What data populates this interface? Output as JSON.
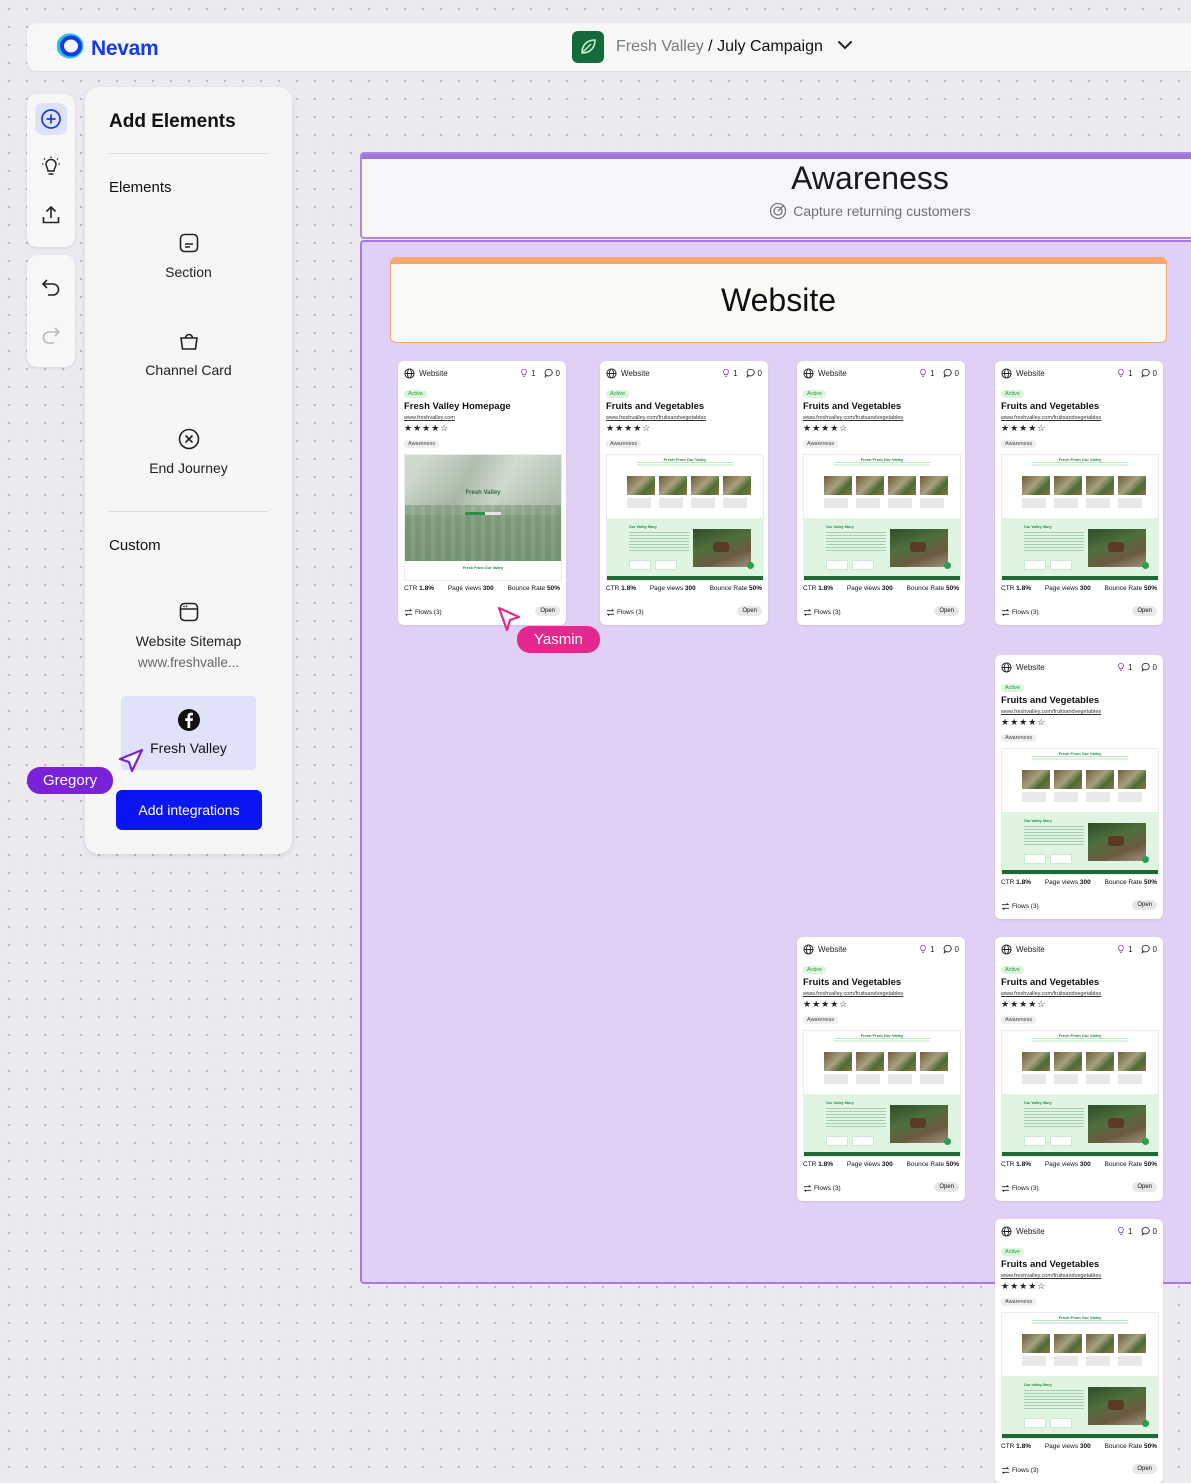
{
  "header": {
    "brand": "Nevam",
    "project": "Fresh Valley",
    "separator": " / ",
    "campaign": "July Campaign"
  },
  "toolbar": {
    "top_icons": [
      "add-circle-icon",
      "lightbulb-icon",
      "upload-icon"
    ],
    "history_icons": [
      "undo-icon",
      "redo-icon"
    ]
  },
  "panel": {
    "title": "Add Elements",
    "elements_heading": "Elements",
    "elements": [
      {
        "label": "Section",
        "icon": "section-icon"
      },
      {
        "label": "Channel Card",
        "icon": "basket-icon"
      },
      {
        "label": "End Journey",
        "icon": "close-circle-icon"
      }
    ],
    "custom_heading": "Custom",
    "custom": [
      {
        "label": "Website Sitemap",
        "sub": "www.freshvalle...",
        "icon": "browser-icon"
      },
      {
        "label": "Fresh Valley",
        "icon": "facebook-icon"
      }
    ],
    "add_button": "Add integrations"
  },
  "canvas": {
    "stage_title": "Awareness",
    "stage_subtitle": "Capture returning customers",
    "channel_title": "Website"
  },
  "cards": [
    {
      "channel": "Website",
      "ideas": "1",
      "comments": "0",
      "status": "Active",
      "title": "Fresh Valley Homepage",
      "url": "www.freshvalley.com",
      "rating": "★★★★☆",
      "tag": "Awareness",
      "preview": "homepage",
      "preview_title": "Fresh Valley",
      "preview_footer": "Fresh From Our Valley",
      "ctr_label": "CTR",
      "ctr": "1.8%",
      "views_label": "Page views",
      "views": "300",
      "bounce_label": "Bounce Rate",
      "bounce": "50%",
      "flows": "Flows (3)",
      "open": "Open"
    },
    {
      "channel": "Website",
      "ideas": "1",
      "comments": "0",
      "status": "Active",
      "title": "Fruits and Vegetables",
      "url": "www.freshvalley.com/fruitsandvegetables",
      "rating": "★★★★☆",
      "tag": "Awareness",
      "preview": "product",
      "preview_title": "Fresh From Our Valley",
      "preview_story": "Our Valley Story",
      "ctr_label": "CTR",
      "ctr": "1.8%",
      "views_label": "Page views",
      "views": "300",
      "bounce_label": "Bounce Rate",
      "bounce": "50%",
      "flows": "Flows (3)",
      "open": "Open"
    },
    {
      "channel": "Website",
      "ideas": "1",
      "comments": "0",
      "status": "Active",
      "title": "Fruits and Vegetables",
      "url": "www.freshvalley.com/fruitsandvegetables",
      "rating": "★★★★☆",
      "tag": "Awareness",
      "preview": "product",
      "preview_title": "Fresh From Our Valley",
      "preview_story": "Our Valley Story",
      "ctr_label": "CTR",
      "ctr": "1.8%",
      "views_label": "Page views",
      "views": "300",
      "bounce_label": "Bounce Rate",
      "bounce": "50%",
      "flows": "Flows (3)",
      "open": "Open"
    },
    {
      "channel": "Website",
      "ideas": "1",
      "comments": "0",
      "status": "Active",
      "title": "Fruits and Vegetables",
      "url": "www.freshvalley.com/fruitsandvegetables",
      "rating": "★★★★☆",
      "tag": "Awareness",
      "preview": "product",
      "preview_title": "Fresh From Our Valley",
      "preview_story": "Our Valley Story",
      "ctr_label": "CTR",
      "ctr": "1.8%",
      "views_label": "Page views",
      "views": "300",
      "bounce_label": "Bounce Rate",
      "bounce": "50%",
      "flows": "Flows (3)",
      "open": "Open"
    },
    {
      "channel": "Website",
      "ideas": "1",
      "comments": "0",
      "status": "Active",
      "title": "Fruits and Vegetables",
      "url": "www.freshvalley.com/fruitsandvegetables",
      "rating": "★★★★☆",
      "tag": "Awareness",
      "preview": "product",
      "preview_title": "Fresh From Our Valley",
      "preview_story": "Our Valley Story",
      "ctr_label": "CTR",
      "ctr": "1.8%",
      "views_label": "Page views",
      "views": "300",
      "bounce_label": "Bounce Rate",
      "bounce": "50%",
      "flows": "Flows (3)",
      "open": "Open"
    },
    {
      "channel": "Website",
      "ideas": "1",
      "comments": "0",
      "status": "Active",
      "title": "Fruits and Vegetables",
      "url": "www.freshvalley.com/fruitsandvegetables",
      "rating": "★★★★☆",
      "tag": "Awareness",
      "preview": "product",
      "preview_title": "Fresh From Our Valley",
      "preview_story": "Our Valley Story",
      "ctr_label": "CTR",
      "ctr": "1.8%",
      "views_label": "Page views",
      "views": "300",
      "bounce_label": "Bounce Rate",
      "bounce": "50%",
      "flows": "Flows (3)",
      "open": "Open"
    },
    {
      "channel": "Website",
      "ideas": "1",
      "comments": "0",
      "status": "Active",
      "title": "Fruits and Vegetables",
      "url": "www.freshvalley.com/fruitsandvegetables",
      "rating": "★★★★☆",
      "tag": "Awareness",
      "preview": "product",
      "preview_title": "Fresh From Our Valley",
      "preview_story": "Our Valley Story",
      "ctr_label": "CTR",
      "ctr": "1.8%",
      "views_label": "Page views",
      "views": "300",
      "bounce_label": "Bounce Rate",
      "bounce": "50%",
      "flows": "Flows (3)",
      "open": "Open"
    },
    {
      "channel": "Website",
      "ideas": "1",
      "comments": "0",
      "status": "Active",
      "title": "Fruits and Vegetables",
      "url": "www.freshvalley.com/fruitsandvegetables",
      "rating": "★★★★☆",
      "tag": "Awareness",
      "preview": "product",
      "preview_title": "Fresh From Our Valley",
      "preview_story": "Our Valley Story",
      "ctr_label": "CTR",
      "ctr": "1.8%",
      "views_label": "Page views",
      "views": "300",
      "bounce_label": "Bounce Rate",
      "bounce": "50%",
      "flows": "Flows (3)",
      "open": "Open"
    }
  ],
  "collaborators": [
    {
      "name": "Yasmin",
      "color": "#e4288d"
    },
    {
      "name": "Gregory",
      "color": "#7a22d8"
    }
  ],
  "colors": {
    "brand": "#1839e8",
    "primary_button": "#0a16f2",
    "stage_border": "#9f72dd",
    "stage_fill": "#e1d0f5",
    "channel_accent": "#f6a86c",
    "active_green": "#2f9a3f"
  }
}
